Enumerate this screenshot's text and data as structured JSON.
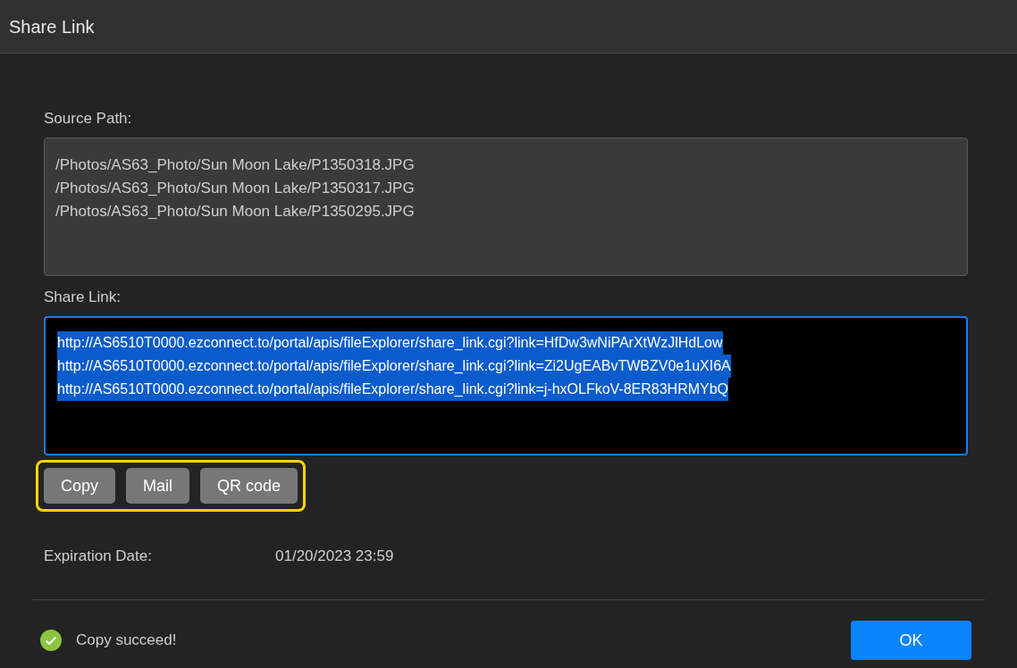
{
  "window": {
    "title": "Share Link"
  },
  "source_path": {
    "label": "Source Path:",
    "lines": [
      "/Photos/AS63_Photo/Sun Moon Lake/P1350318.JPG",
      "/Photos/AS63_Photo/Sun Moon Lake/P1350317.JPG",
      "/Photos/AS63_Photo/Sun Moon Lake/P1350295.JPG"
    ]
  },
  "share_link": {
    "label": "Share Link:",
    "focused": true,
    "selected": true,
    "lines": [
      "http://AS6510T0000.ezconnect.to/portal/apis/fileExplorer/share_link.cgi?link=HfDw3wNiPArXtWzJlHdLow",
      "http://AS6510T0000.ezconnect.to/portal/apis/fileExplorer/share_link.cgi?link=Zi2UgEABvTWBZV0e1uXI6A",
      "http://AS6510T0000.ezconnect.to/portal/apis/fileExplorer/share_link.cgi?link=j-hxOLFkoV-8ER83HRMYbQ"
    ]
  },
  "action_buttons": {
    "highlighted": true,
    "buttons": [
      "Copy",
      "Mail",
      "QR code"
    ]
  },
  "expiration": {
    "label": "Expiration Date:",
    "value": "01/20/2023 23:59"
  },
  "status": {
    "kind": "success",
    "message": "Copy succeed!"
  },
  "ok_button": "OK"
}
